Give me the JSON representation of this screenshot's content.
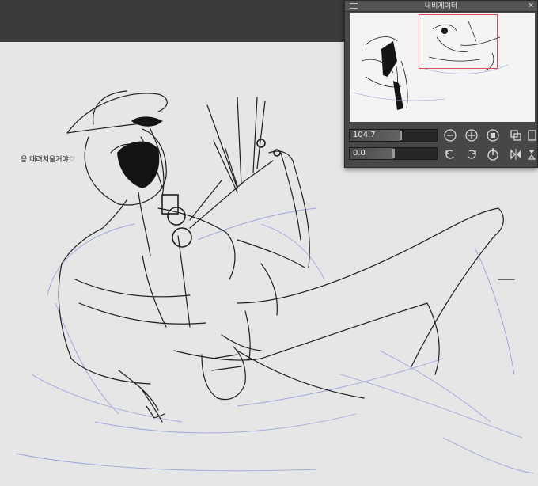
{
  "canvas": {
    "speech_text": "응 때려치울거야♡"
  },
  "navigator": {
    "title": "내비게이터",
    "close_label": "✕",
    "zoom_value": "104.7",
    "rotation_value": "0.0",
    "zoom_level_fraction": 0.58,
    "rotation_level_fraction": 0.5
  },
  "icons": {
    "zoom_out": "zoom-out-icon",
    "zoom_in": "zoom-in-icon",
    "fit": "fit-screen-icon",
    "actual_size": "actual-size-icon",
    "rotate_left": "rotate-left-icon",
    "rotate_right": "rotate-right-icon",
    "reset_rotation": "reset-rotation-icon",
    "flip_horizontal": "flip-horizontal-icon"
  },
  "colors": {
    "toolbar": "#3b3b3b",
    "panel": "#474747",
    "canvas": "#e6e6e6",
    "viewport_frame": "#d9505a"
  }
}
